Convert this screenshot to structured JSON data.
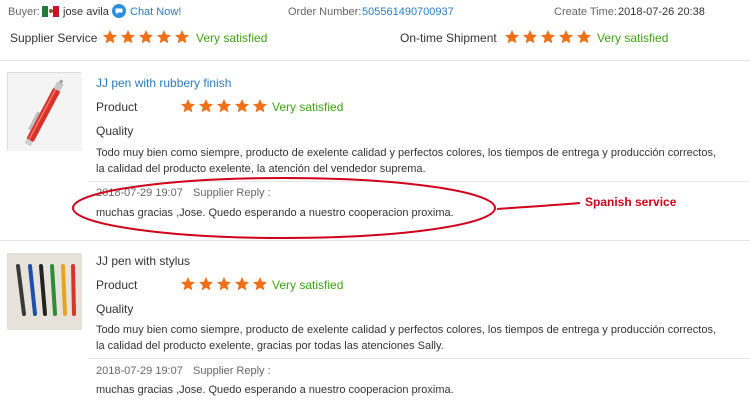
{
  "header": {
    "buyer_label": "Buyer:",
    "buyer_name": "jose avila",
    "chat_label": "Chat Now!",
    "order_label": "Order Number:",
    "order_number": "505561490700937",
    "create_label": "Create Time:",
    "create_time": "2018-07-26 20:38"
  },
  "ratings": {
    "supplier_service_label": "Supplier Service",
    "supplier_service_text": "Very satisfied",
    "supplier_service_stars": 5,
    "shipment_label": "On-time Shipment",
    "shipment_text": "Very satisfied",
    "shipment_stars": 5
  },
  "reviews": [
    {
      "product_name": "JJ pen with rubbery finish",
      "product_label": "Product",
      "product_rating_text": "Very satisfied",
      "product_stars": 5,
      "quality_label": "Quality",
      "comment_line1": "Todo muy bien como siempre, producto de exelente calidad y perfectos colores, los tiempos de entrega y producción correctos,",
      "comment_line2": "la calidad del producto exelente, la atención del vendedor suprema.",
      "reply_date": "2018-07-29 19:07",
      "reply_label": "Supplier Reply :",
      "reply_text": "muchas gracias ,Jose. Quedo esperando a nuestro cooperacion proxima."
    },
    {
      "product_name": "JJ pen with stylus",
      "product_label": "Product",
      "product_rating_text": "Very satisfied",
      "product_stars": 5,
      "quality_label": "Quality",
      "comment_line1": "Todo muy bien como siempre, producto de exelente calidad y perfectos colores, los tiempos de entrega y producción correctos,",
      "comment_line2": "la calidad del producto exelente, gracias por todas las atenciones Sally.",
      "reply_date": "2018-07-29 19:07",
      "reply_label": "Supplier Reply :",
      "reply_text": "muchas gracias ,Jose. Quedo esperando a nuestro cooperacion proxima."
    }
  ],
  "annotation": {
    "label": "Spanish service",
    "color": "#d0021b"
  },
  "colors": {
    "star": "#f0701a",
    "link": "#2a7bbf",
    "satisfied": "#3da311"
  }
}
